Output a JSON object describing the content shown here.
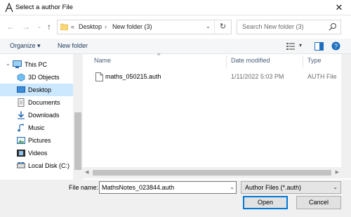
{
  "window": {
    "title": "Select a author File"
  },
  "nav": {
    "path": [
      "Desktop",
      "New folder (3)"
    ],
    "overflow": "«",
    "search_placeholder": "Search New folder (3)"
  },
  "toolbar": {
    "organize": "Organize",
    "new_folder": "New folder"
  },
  "sidebar": {
    "items": [
      {
        "label": "This PC",
        "icon": "pc-icon"
      },
      {
        "label": "3D Objects",
        "icon": "cube-icon"
      },
      {
        "label": "Desktop",
        "icon": "desktop-icon",
        "selected": true
      },
      {
        "label": "Documents",
        "icon": "documents-icon"
      },
      {
        "label": "Downloads",
        "icon": "download-icon"
      },
      {
        "label": "Music",
        "icon": "music-icon"
      },
      {
        "label": "Pictures",
        "icon": "pictures-icon"
      },
      {
        "label": "Videos",
        "icon": "videos-icon"
      },
      {
        "label": "Local Disk (C:)",
        "icon": "disk-icon"
      }
    ]
  },
  "columns": {
    "name": "Name",
    "date": "Date modified",
    "type": "Type"
  },
  "files": [
    {
      "name": "maths_050215.auth",
      "date": "1/11/2022 5:03 PM",
      "type": "AUTH File"
    }
  ],
  "footer": {
    "file_name_label": "File name:",
    "file_name_value": "MathsNotes_023844.auth",
    "file_type": "Author Files (*.auth)",
    "open": "Open",
    "cancel": "Cancel"
  },
  "colors": {
    "selection": "#cce8ff",
    "accent": "#0078d7",
    "toolbar_text": "#1e395b"
  }
}
